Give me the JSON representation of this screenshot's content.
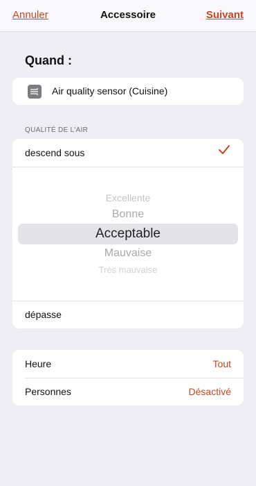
{
  "nav": {
    "cancel": "Annuler",
    "title": "Accessoire",
    "next": "Suivant"
  },
  "when": {
    "title": "Quand :"
  },
  "device": {
    "label": "Air quality sensor (Cuisine)",
    "icon": "air-flow-icon"
  },
  "condition": {
    "header": "QUALITÉ DE L'AIR",
    "selected_row": "descend sous",
    "other_row": "dépasse",
    "picker": [
      "Excellente",
      "Bonne",
      "Acceptable",
      "Mauvaise",
      "Très mauvaise"
    ],
    "picker_selected": "Acceptable"
  },
  "options": [
    {
      "label": "Heure",
      "value": "Tout"
    },
    {
      "label": "Personnes",
      "value": "Désactivé"
    }
  ],
  "colors": {
    "accent": "#c9441f",
    "background": "#efeef4"
  }
}
